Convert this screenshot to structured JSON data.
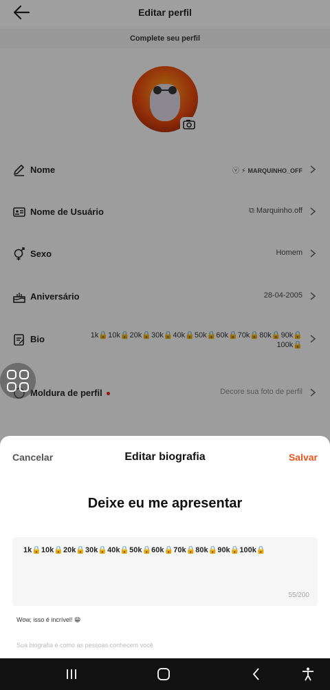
{
  "header": {
    "title": "Editar perfil",
    "subtitle": "Complete seu perfil"
  },
  "rows": [
    {
      "label": "Nome",
      "value": "MARQUINHO_OFF",
      "icon": "pencil-icon"
    },
    {
      "label": "Nome de Usuário",
      "value": "Marquinho.off",
      "icon": "id-card-icon"
    },
    {
      "label": "Sexo",
      "value": "Homem",
      "icon": "gender-icon"
    },
    {
      "label": "Aniversário",
      "value": "28-04-2005",
      "icon": "cake-icon"
    },
    {
      "label": "Bio",
      "value": "1k🔒10k🔒20k🔒30k🔒40k🔒50k🔒60k🔒70k🔒80k🔒90k🔒100k🔒",
      "icon": "edit-doc-icon"
    },
    {
      "label": "Moldura de perfil",
      "value": "Decore sua foto de perfil",
      "icon": "frame-icon"
    }
  ],
  "sheet": {
    "cancel": "Cancelar",
    "title": "Editar biografia",
    "save": "Salvar",
    "heading": "Deixe eu me apresentar",
    "bio_text": "1k🔒10k🔒20k🔒30k🔒40k🔒50k🔒60k🔒70k🔒80k🔒90k🔒100k🔒",
    "counter": "55/200",
    "suggestion": "Wow, isso é incrível! 😁",
    "hint": "Sua biografia é como as pessoas conhecem você"
  },
  "colors": {
    "accent": "#e8541a",
    "red_dot": "#e02020"
  }
}
